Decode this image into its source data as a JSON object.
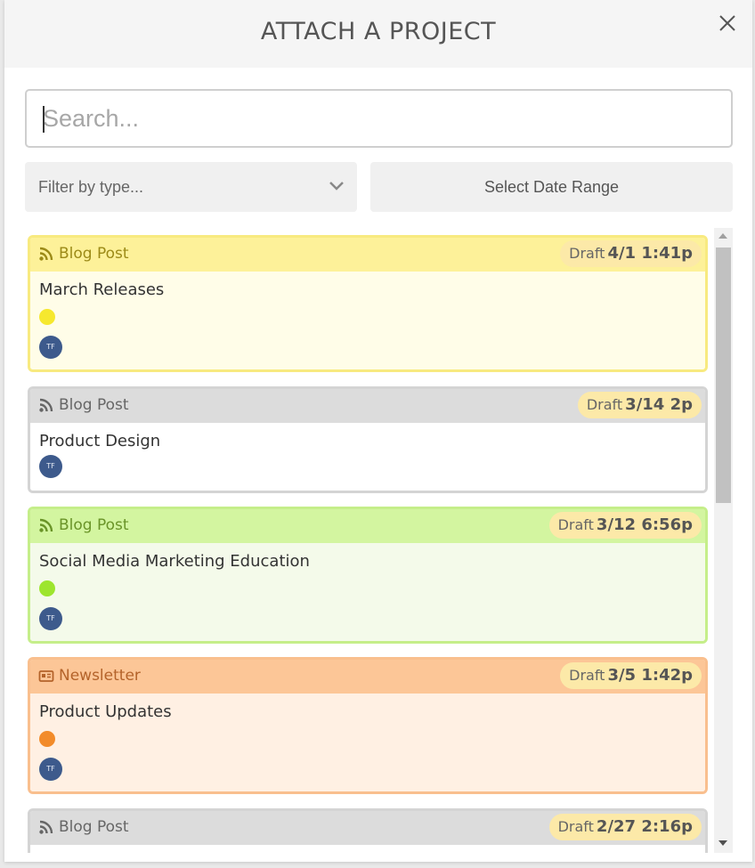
{
  "modal": {
    "title": "ATTACH A PROJECT"
  },
  "search": {
    "placeholder": "Search..."
  },
  "filters": {
    "type_placeholder": "Filter by type...",
    "date_range_label": "Select Date Range"
  },
  "projects": [
    {
      "type": "Blog Post",
      "type_icon": "rss-icon",
      "status": "Draft",
      "date": "4/1 1:41p",
      "title": "March Releases",
      "avatar": "TF",
      "header_color": "#fdf199",
      "body_color": "#fffde8",
      "border_color": "#f8ea80",
      "type_color": "#9c8a17",
      "dot_color": "#f6e82e"
    },
    {
      "type": "Blog Post",
      "type_icon": "rss-icon",
      "status": "Draft",
      "date": "3/14 2p",
      "title": "Product Design",
      "avatar": "TF",
      "header_color": "#dcdcdc",
      "body_color": "#ffffff",
      "border_color": "#d4d4d4",
      "type_color": "#666666",
      "dot_color": null
    },
    {
      "type": "Blog Post",
      "type_icon": "rss-icon",
      "status": "Draft",
      "date": "3/12 6:56p",
      "title": "Social Media Marketing Education",
      "avatar": "TF",
      "header_color": "#d3f5a0",
      "body_color": "#f4faea",
      "border_color": "#c5ee8a",
      "type_color": "#6a9428",
      "dot_color": "#9de52e"
    },
    {
      "type": "Newsletter",
      "type_icon": "newspaper-icon",
      "status": "Draft",
      "date": "3/5 1:42p",
      "title": "Product Updates",
      "avatar": "TF",
      "header_color": "#fcc697",
      "body_color": "#fff0e3",
      "border_color": "#f9bf8e",
      "type_color": "#b4632a",
      "dot_color": "#f28b2a"
    },
    {
      "type": "Blog Post",
      "type_icon": "rss-icon",
      "status": "Draft",
      "date": "2/27 2:16p",
      "title": "",
      "avatar": "",
      "header_color": "#dcdcdc",
      "body_color": "#ffffff",
      "border_color": "#d4d4d4",
      "type_color": "#666666",
      "dot_color": null
    }
  ]
}
